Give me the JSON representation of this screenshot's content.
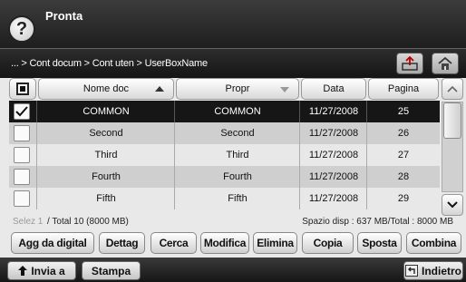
{
  "header": {
    "help_symbol": "?",
    "title": "Pronta"
  },
  "breadcrumb": {
    "path": "... > Cont docum > Cont uten > UserBoxName"
  },
  "toolbar": {
    "save_icon": "tray-upload-icon",
    "home_icon": "home-icon"
  },
  "table": {
    "columns": [
      "Nome doc",
      "Propr",
      "Data",
      "Pagina"
    ],
    "sort": {
      "column": "Nome doc",
      "direction": "ascending"
    },
    "rows": [
      {
        "name": "COMMON",
        "owner": "COMMON",
        "date": "11/27/2008",
        "pages": "25",
        "checked": true,
        "selected": true
      },
      {
        "name": "Second",
        "owner": "Second",
        "date": "11/27/2008",
        "pages": "26",
        "checked": false,
        "selected": false
      },
      {
        "name": "Third",
        "owner": "Third",
        "date": "11/27/2008",
        "pages": "27",
        "checked": false,
        "selected": false
      },
      {
        "name": "Fourth",
        "owner": "Fourth",
        "date": "11/27/2008",
        "pages": "28",
        "checked": false,
        "selected": false
      },
      {
        "name": "Fifth",
        "owner": "Fifth",
        "date": "11/27/2008",
        "pages": "29",
        "checked": false,
        "selected": false
      }
    ]
  },
  "status": {
    "selected": "Selez 1",
    "total": "/ Total 10 (8000 MB)",
    "space": "Spazio disp : 637 MB/Total : 8000 MB"
  },
  "actions": [
    "Agg da digital",
    "Dettag",
    "Cerca",
    "Modifica",
    "Elimina",
    "Copia",
    "Sposta",
    "Combina"
  ],
  "bottom": {
    "send": "Invia a",
    "print": "Stampa",
    "back": "Indietro"
  },
  "colors": {
    "selected_row": "#161616",
    "odd_row": "#cfcfcf",
    "even_row": "#e8e8e8",
    "header_bar": "#1e1e1e"
  }
}
